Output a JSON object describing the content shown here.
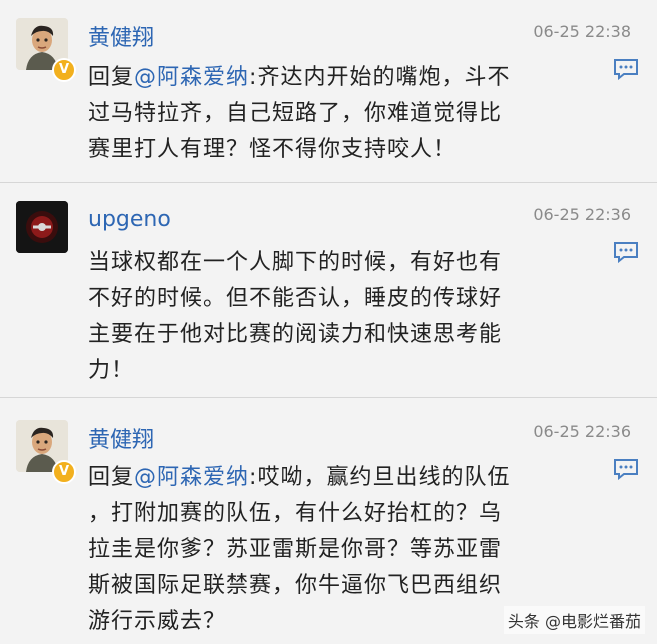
{
  "comments": [
    {
      "username": "黄健翔",
      "time": "06-25 22:38",
      "verified": true,
      "reply_prefix": "回复",
      "mention": "@阿森爱纳",
      "lines": [
        ":齐达内开始的嘴炮，斗不",
        "过马特拉齐，自己短路了，你难道觉得比",
        "赛里打人有理？怪不得你支持咬人！"
      ]
    },
    {
      "username": "upgeno",
      "time": "06-25 22:36",
      "verified": false,
      "lines": [
        "当球权都在一个人脚下的时候，有好也有",
        "不好的时候。但不能否认，睡皮的传球好",
        "主要在于他对比赛的阅读力和快速思考能",
        "力！"
      ]
    },
    {
      "username": "黄健翔",
      "time": "06-25 22:36",
      "verified": true,
      "reply_prefix": "回复",
      "mention": "@阿森爱纳",
      "lines": [
        ":哎呦，赢约旦出线的队伍",
        "，打附加赛的队伍，有什么好抬杠的？乌",
        "拉圭是你爹？苏亚雷斯是你哥？等苏亚雷",
        "斯被国际足联禁赛，你牛逼你飞巴西组织",
        "游行示威去？"
      ]
    }
  ],
  "badge_symbol": "V",
  "watermark": "头条 @电影烂番茄",
  "colors": {
    "username": "#2d66b3",
    "mention": "#2d66b3",
    "timestamp": "#8a8a8a",
    "badge": "#f2b01e",
    "reply_icon": "#4a7fc1"
  }
}
